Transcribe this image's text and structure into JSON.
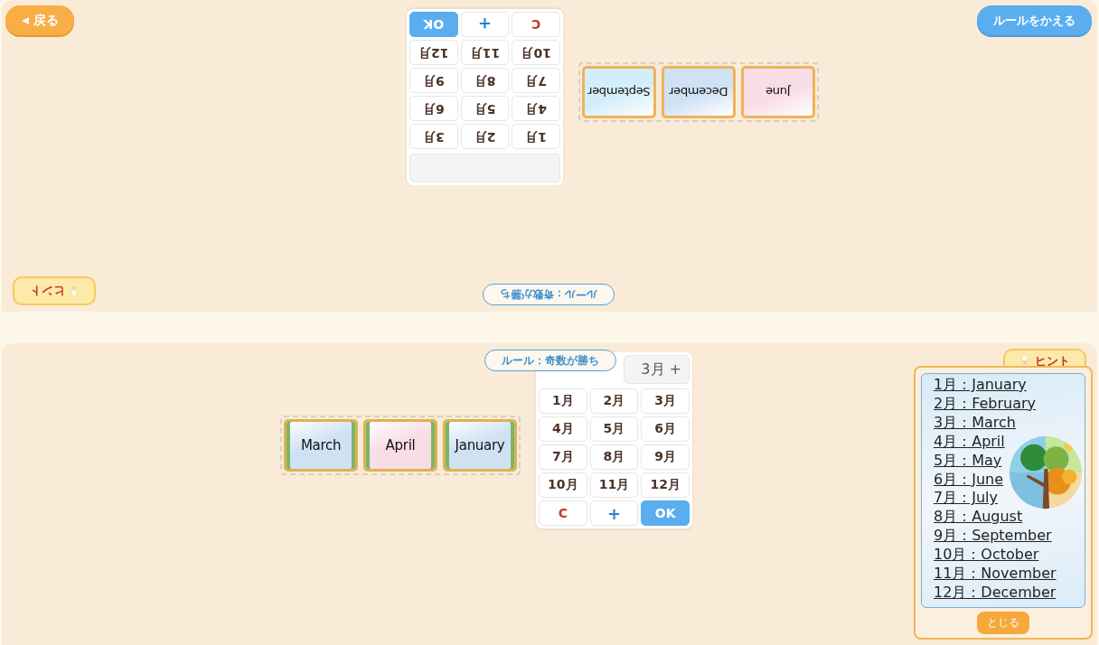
{
  "back_button": {
    "label": "戻る"
  },
  "rule_button": {
    "label": "ルールをかえる"
  },
  "players": [
    {
      "rotated": true,
      "rule": "ルール：奇数が勝ち",
      "cards": [
        {
          "label": "June",
          "color": "#f9dde6",
          "highlighted": false
        },
        {
          "label": "December",
          "color": "#cfe2f4",
          "highlighted": false
        },
        {
          "label": "September",
          "color": "#d3eefa",
          "highlighted": false
        }
      ],
      "keypad": {
        "keys": [
          {
            "label": "1月",
            "kind": "month"
          },
          {
            "label": "2月",
            "kind": "month"
          },
          {
            "label": "3月",
            "kind": "month"
          },
          {
            "label": "4月",
            "kind": "month"
          },
          {
            "label": "5月",
            "kind": "month"
          },
          {
            "label": "6月",
            "kind": "month"
          },
          {
            "label": "7月",
            "kind": "month"
          },
          {
            "label": "8月",
            "kind": "month"
          },
          {
            "label": "9月",
            "kind": "month"
          },
          {
            "label": "10月",
            "kind": "month"
          },
          {
            "label": "11月",
            "kind": "month"
          },
          {
            "label": "12月",
            "kind": "month"
          },
          {
            "label": "C",
            "kind": "clear"
          },
          {
            "label": "+",
            "kind": "plus"
          },
          {
            "label": "OK",
            "kind": "ok"
          }
        ]
      },
      "hint": {
        "label": "ヒント",
        "expanded": false
      }
    },
    {
      "rotated": false,
      "rule": "ルール：奇数が勝ち",
      "cards": [
        {
          "label": "March",
          "color": "#cfe2f4",
          "highlighted": true
        },
        {
          "label": "April",
          "color": "#f9dde6",
          "highlighted": true
        },
        {
          "label": "January",
          "color": "#cfe2f4",
          "highlighted": true
        }
      ],
      "keypad": {
        "display": "3月 +",
        "keys": [
          {
            "label": "1月",
            "kind": "month"
          },
          {
            "label": "2月",
            "kind": "month"
          },
          {
            "label": "3月",
            "kind": "month"
          },
          {
            "label": "4月",
            "kind": "month"
          },
          {
            "label": "5月",
            "kind": "month"
          },
          {
            "label": "6月",
            "kind": "month"
          },
          {
            "label": "7月",
            "kind": "month"
          },
          {
            "label": "8月",
            "kind": "month"
          },
          {
            "label": "9月",
            "kind": "month"
          },
          {
            "label": "10月",
            "kind": "month"
          },
          {
            "label": "11月",
            "kind": "month"
          },
          {
            "label": "12月",
            "kind": "month"
          },
          {
            "label": "C",
            "kind": "clear"
          },
          {
            "label": "+",
            "kind": "plus"
          },
          {
            "label": "OK",
            "kind": "ok"
          }
        ]
      },
      "hint": {
        "label": "ヒント",
        "expanded": true,
        "items": [
          "1月：January",
          "2月：February",
          "3月：March",
          "4月：April",
          "5月：May",
          "6月：June",
          "7月：July",
          "8月：August",
          "9月：September",
          "10月：October",
          "11月：November",
          "12月：December"
        ],
        "close_label": "とじる"
      }
    }
  ]
}
